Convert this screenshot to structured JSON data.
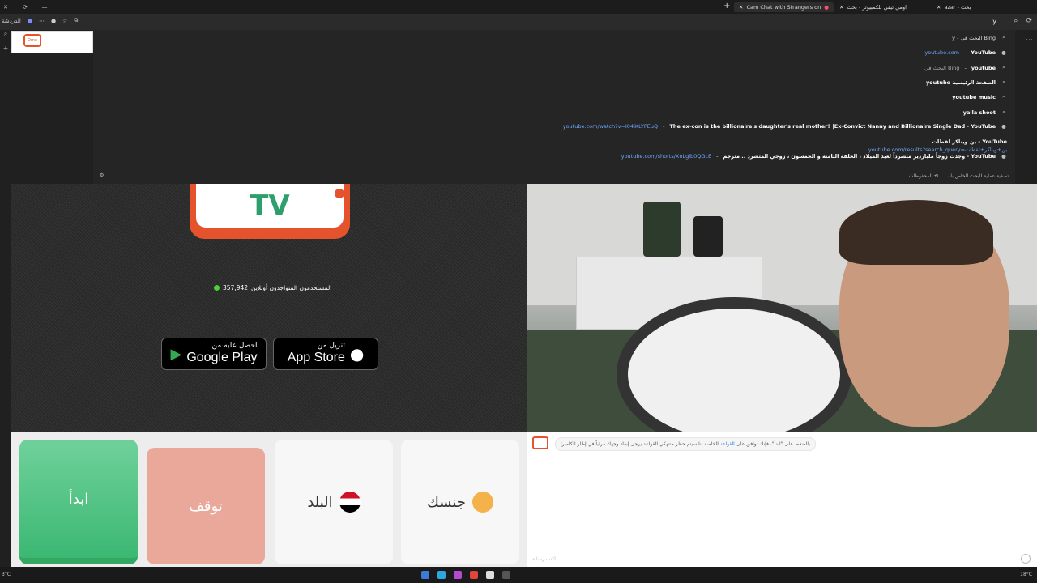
{
  "tabs": [
    {
      "label": "Cam Chat with Strangers on",
      "active": true
    },
    {
      "label": "اومي تيفي للكمبيوتر - بحث",
      "active": false
    },
    {
      "label": "azar - بحث",
      "active": false
    }
  ],
  "address": {
    "query": "y"
  },
  "suggestions": [
    {
      "text": "y - البحث في Bing",
      "kind": "search"
    },
    {
      "url": "youtube.com",
      "title": "YouTube",
      "kind": "site"
    },
    {
      "text": "youtube",
      "suffix": "البحث في Bing",
      "kind": "search"
    },
    {
      "text": "youtube الصفحة الرئيسية",
      "kind": "search"
    },
    {
      "text": "youtube music",
      "kind": "search"
    },
    {
      "text": "yalla shoot",
      "kind": "search"
    },
    {
      "url": "youtube.com/watch?v=I04iKLYPEuQ",
      "title": "The ex-con is the billionaire's daughter's real mother? |Ex-Convict Nanny and Billionaire Single Dad - YouTube",
      "kind": "site"
    },
    {
      "url": "youtube.com/results?search_query=بن+ويناكر+لقطات",
      "title": "بن ويناكر لقطات - YouTube",
      "kind": "site"
    },
    {
      "url": "youtube.com/shorts/XnLglb0QGcE",
      "title": "وجدت زوجاً ملياردير متشرداً لعيد الميلاد ، الحلقة الثامنة و الخمسون ، زوجي المتشرد .. مترجم - YouTube",
      "kind": "site"
    }
  ],
  "suggest_footer": {
    "saved": "المحفوظات",
    "clear": "تصفية عملية البحث الخاص بك"
  },
  "tv_label": "TV",
  "online": {
    "count": "357,942",
    "label": "المستخدمون المتواجدون أونلاين"
  },
  "stores": {
    "google": {
      "small": "احصل عليه من",
      "big": "Google Play"
    },
    "apple": {
      "small": "تنزيل من",
      "big": "App Store"
    }
  },
  "buttons": {
    "start": "ابدأ",
    "stop": "توقف",
    "country": "البلد",
    "gender": "جنسك"
  },
  "chat": {
    "message_pre": "بالضغط على \"ابدأ\"، فإنك توافق على",
    "message_link": "القواعد",
    "message_post": "الخاصة بنا سيتم حظر منتهكي القواعد يرجى إبقاء وجهك مرئياً في إطار الكاميرا",
    "input_placeholder": "اكتب رسالة..."
  },
  "taskbar": {
    "left": "3°C",
    "right": "18°C"
  },
  "sidebar_label": "الدردشة"
}
